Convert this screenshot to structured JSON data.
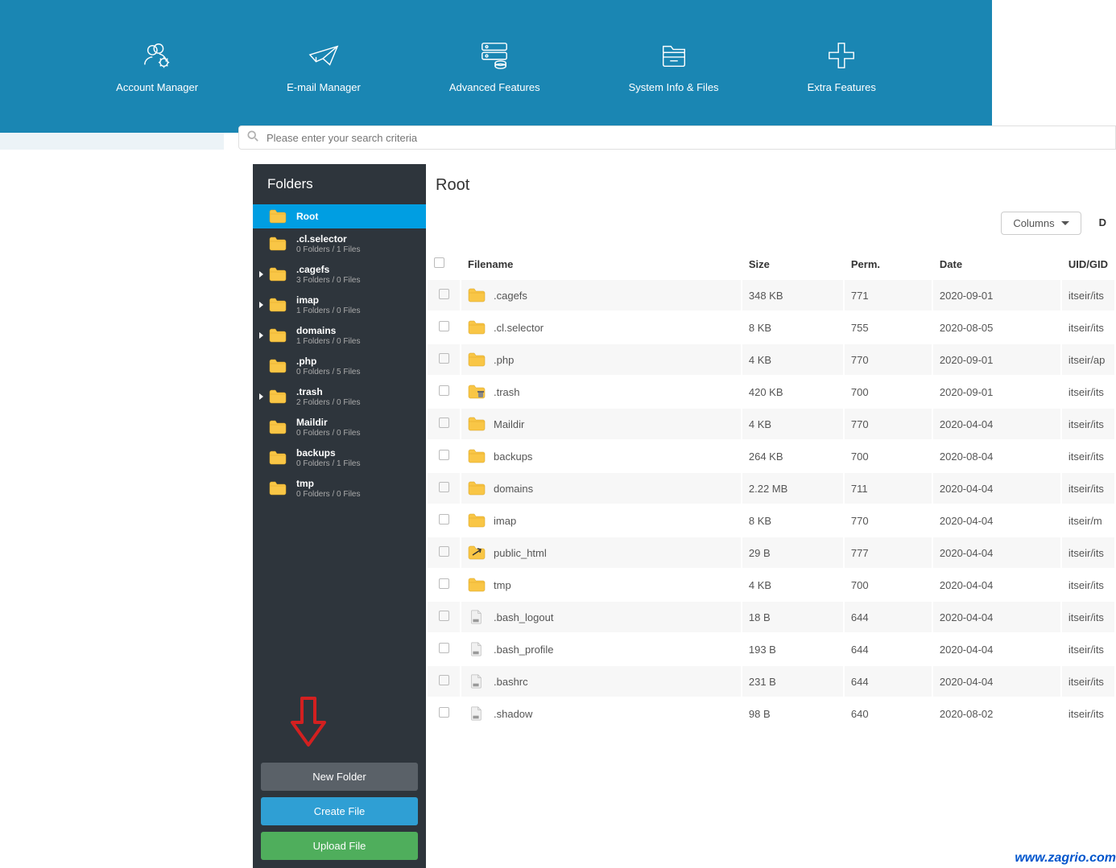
{
  "nav": {
    "items": [
      {
        "label": "Account Manager"
      },
      {
        "label": "E-mail Manager"
      },
      {
        "label": "Advanced Features"
      },
      {
        "label": "System Info & Files"
      },
      {
        "label": "Extra Features"
      }
    ]
  },
  "search": {
    "placeholder": "Please enter your search criteria"
  },
  "sidebar": {
    "title": "Folders",
    "items": [
      {
        "name": "Root",
        "meta": "",
        "active": true,
        "arrow": false
      },
      {
        "name": ".cl.selector",
        "meta": "0 Folders / 1 Files",
        "active": false,
        "arrow": false
      },
      {
        "name": ".cagefs",
        "meta": "3 Folders / 0 Files",
        "active": false,
        "arrow": true
      },
      {
        "name": "imap",
        "meta": "1 Folders / 0 Files",
        "active": false,
        "arrow": true
      },
      {
        "name": "domains",
        "meta": "1 Folders / 0 Files",
        "active": false,
        "arrow": true
      },
      {
        "name": ".php",
        "meta": "0 Folders / 5 Files",
        "active": false,
        "arrow": false
      },
      {
        "name": ".trash",
        "meta": "2 Folders / 0 Files",
        "active": false,
        "arrow": true
      },
      {
        "name": "Maildir",
        "meta": "0 Folders / 0 Files",
        "active": false,
        "arrow": false
      },
      {
        "name": "backups",
        "meta": "0 Folders / 1 Files",
        "active": false,
        "arrow": false
      },
      {
        "name": "tmp",
        "meta": "0 Folders / 0 Files",
        "active": false,
        "arrow": false
      }
    ],
    "actions": {
      "new_folder": "New Folder",
      "create_file": "Create File",
      "upload_file": "Upload File"
    }
  },
  "main": {
    "title": "Root",
    "columns_btn": "Columns",
    "d_btn": "D",
    "headers": {
      "filename": "Filename",
      "size": "Size",
      "perm": "Perm.",
      "date": "Date",
      "uidgid": "UID/GID"
    },
    "rows": [
      {
        "icon": "folder",
        "name": ".cagefs",
        "size": "348 KB",
        "perm": "771",
        "date": "2020-09-01",
        "uidgid": "itseir/its"
      },
      {
        "icon": "folder",
        "name": ".cl.selector",
        "size": "8 KB",
        "perm": "755",
        "date": "2020-08-05",
        "uidgid": "itseir/its"
      },
      {
        "icon": "folder",
        "name": ".php",
        "size": "4 KB",
        "perm": "770",
        "date": "2020-09-01",
        "uidgid": "itseir/ap"
      },
      {
        "icon": "trash",
        "name": ".trash",
        "size": "420 KB",
        "perm": "700",
        "date": "2020-09-01",
        "uidgid": "itseir/its"
      },
      {
        "icon": "folder",
        "name": "Maildir",
        "size": "4 KB",
        "perm": "770",
        "date": "2020-04-04",
        "uidgid": "itseir/its"
      },
      {
        "icon": "folder",
        "name": "backups",
        "size": "264 KB",
        "perm": "700",
        "date": "2020-08-04",
        "uidgid": "itseir/its"
      },
      {
        "icon": "folder",
        "name": "domains",
        "size": "2.22 MB",
        "perm": "711",
        "date": "2020-04-04",
        "uidgid": "itseir/its"
      },
      {
        "icon": "folder",
        "name": "imap",
        "size": "8 KB",
        "perm": "770",
        "date": "2020-04-04",
        "uidgid": "itseir/m"
      },
      {
        "icon": "link",
        "name": "public_html",
        "size": "29 B",
        "perm": "777",
        "date": "2020-04-04",
        "uidgid": "itseir/its"
      },
      {
        "icon": "folder",
        "name": "tmp",
        "size": "4 KB",
        "perm": "700",
        "date": "2020-04-04",
        "uidgid": "itseir/its"
      },
      {
        "icon": "file",
        "name": ".bash_logout",
        "size": "18 B",
        "perm": "644",
        "date": "2020-04-04",
        "uidgid": "itseir/its"
      },
      {
        "icon": "file",
        "name": ".bash_profile",
        "size": "193 B",
        "perm": "644",
        "date": "2020-04-04",
        "uidgid": "itseir/its"
      },
      {
        "icon": "file",
        "name": ".bashrc",
        "size": "231 B",
        "perm": "644",
        "date": "2020-04-04",
        "uidgid": "itseir/its"
      },
      {
        "icon": "file",
        "name": ".shadow",
        "size": "98 B",
        "perm": "640",
        "date": "2020-08-02",
        "uidgid": "itseir/its"
      }
    ]
  },
  "watermark": "www.zagrio.com"
}
